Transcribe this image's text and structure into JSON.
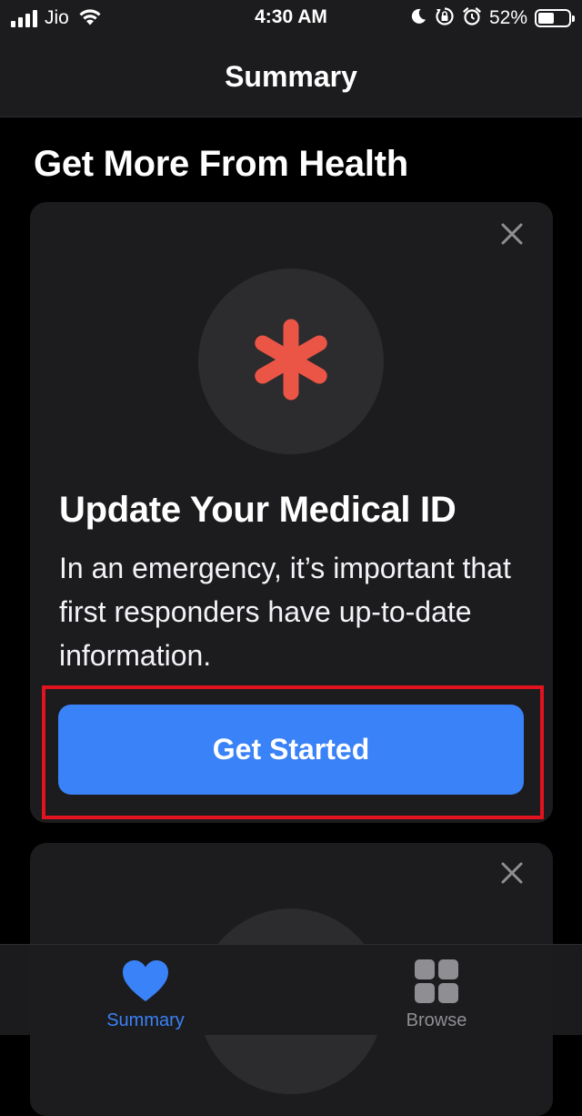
{
  "status_bar": {
    "carrier": "Jio",
    "time": "4:30 AM",
    "battery_percent": "52%",
    "battery_level": 0.52,
    "icons": [
      "signal-icon",
      "wifi-icon",
      "moon-icon",
      "orientation-lock-icon",
      "alarm-icon",
      "battery-icon"
    ]
  },
  "nav": {
    "title": "Summary"
  },
  "section": {
    "header": "Get More From Health"
  },
  "card": {
    "icon": "medical-asterisk-icon",
    "title": "Update Your Medical ID",
    "description": "In an emergency, it’s important that first responders have up-to-date information.",
    "button_label": "Get Started",
    "close_icon": "close-icon"
  },
  "tabs": [
    {
      "label": "Summary",
      "icon": "heart-icon",
      "active": true
    },
    {
      "label": "Browse",
      "icon": "grid-icon",
      "active": false
    }
  ],
  "colors": {
    "background": "#000000",
    "card": "#1c1c1e",
    "accent": "#3a82f7",
    "medical_red": "#eb5545",
    "highlight": "#e0131f",
    "inactive": "#8e8e93"
  }
}
